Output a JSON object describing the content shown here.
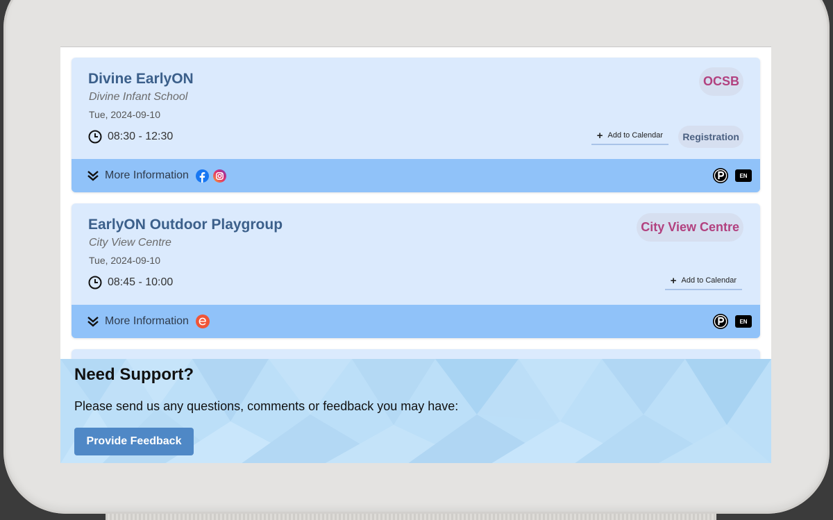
{
  "events": [
    {
      "title": "Divine EarlyON",
      "venue": "Divine Infant School",
      "date": "Tue, 2024-09-10",
      "time": "08:30 - 12:30",
      "tag": "OCSB",
      "add_to_calendar": "Add to Calendar",
      "registration": "Registration",
      "more_info": "More Information",
      "language": "EN",
      "social_icons": [
        "facebook-icon",
        "instagram-icon"
      ]
    },
    {
      "title": "EarlyON Outdoor Playgroup",
      "venue": "City View Centre",
      "date": "Tue, 2024-09-10",
      "time": "08:45 - 10:00",
      "tag": "City View Centre",
      "add_to_calendar": "Add to Calendar",
      "more_info": "More Information",
      "language": "EN",
      "social_icons": [
        "eventbrite-icon"
      ]
    }
  ],
  "support": {
    "title": "Need Support?",
    "text": "Please send us any questions, comments or feedback you may have:",
    "button": "Provide Feedback"
  },
  "colors": {
    "card_bg": "#dbeafd",
    "card_footer": "#90c2f9",
    "title": "#3b5f8a",
    "tag_text": "#b2417f",
    "button": "#4f88c6"
  }
}
